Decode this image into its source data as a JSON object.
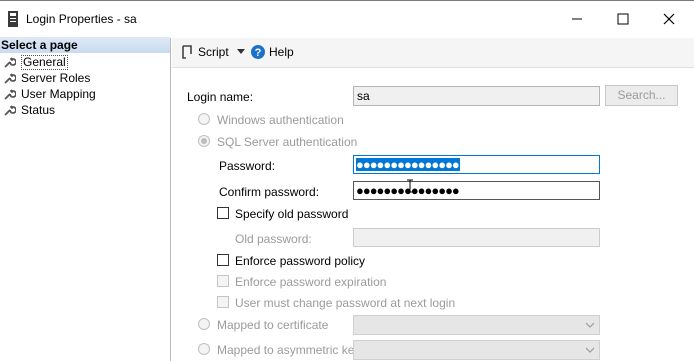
{
  "window": {
    "title": "Login Properties - sa",
    "minimize_icon": "minimize-icon",
    "maximize_icon": "maximize-icon",
    "close_icon": "close-icon"
  },
  "left_pane": {
    "header": "Select a page",
    "items": [
      {
        "label": "General",
        "icon": "wrench-icon",
        "selected": true
      },
      {
        "label": "Server Roles",
        "icon": "wrench-icon"
      },
      {
        "label": "User Mapping",
        "icon": "wrench-icon"
      },
      {
        "label": "Status",
        "icon": "wrench-icon"
      }
    ]
  },
  "toolbar": {
    "script_label": "Script",
    "help_label": "Help"
  },
  "form": {
    "login_name_label": "Login name:",
    "login_name_value": "sa",
    "search_button": "Search...",
    "windows_auth_label": "Windows authentication",
    "sql_auth_label": "SQL Server authentication",
    "password_label": "Password:",
    "password_value": "●●●●●●●●●●●●●●●",
    "confirm_password_label": "Confirm password:",
    "confirm_password_value": "●●●●●●●●●●●●●●●",
    "specify_old_password_label": "Specify old password",
    "old_password_label": "Old password:",
    "enforce_policy_label": "Enforce password policy",
    "enforce_expiration_label": "Enforce password expiration",
    "must_change_label": "User must change password at next login",
    "mapped_certificate_label": "Mapped to certificate",
    "mapped_asym_key_label": "Mapped to asymmetric key"
  },
  "colors": {
    "selection_blue": "#0078d7",
    "header_gradient": "#c9dbf0",
    "disabled_text": "#9b9b9b"
  }
}
